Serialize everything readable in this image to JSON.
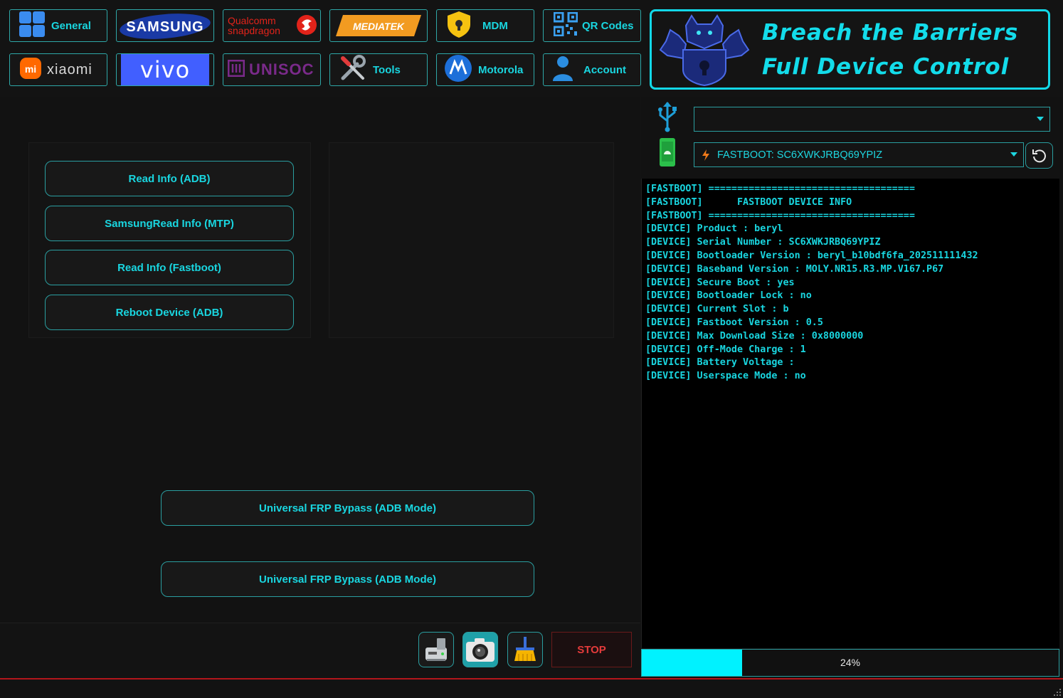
{
  "tabs_row1": [
    {
      "label": "General",
      "icon": "grid-icon"
    },
    {
      "label": "SAMSUNG",
      "icon": "samsung-logo"
    },
    {
      "label": "Qualcomm snapdragon",
      "icon": "snapdragon-logo"
    },
    {
      "label": "MEDIATEK",
      "icon": "mediatek-logo"
    },
    {
      "label": "MDM",
      "icon": "shield-lock-icon"
    },
    {
      "label": "QR Codes",
      "icon": "qr-code-icon"
    }
  ],
  "tabs_row2": [
    {
      "label": "xiaomi",
      "icon": "mi-logo"
    },
    {
      "label": "vivo",
      "icon": "vivo-logo"
    },
    {
      "label": "UNISOC",
      "icon": "unisoc-logo"
    },
    {
      "label": "Tools",
      "icon": "wrench-screwdriver-icon"
    },
    {
      "label": "Motorola",
      "icon": "motorola-logo"
    },
    {
      "label": "Account",
      "icon": "user-icon"
    }
  ],
  "banner": {
    "line1": "Breach the Barriers",
    "line2": "Full Device Control",
    "logo": "cerberus-lock-logo"
  },
  "buttons": {
    "read_adb": "Read Info (ADB)",
    "samsung_mtp": "SamsungRead Info (MTP)",
    "read_fastboot": "Read Info (Fastboot)",
    "reboot_adb": "Reboot Device (ADB)",
    "frp1": "Universal FRP Bypass (ADB Mode)",
    "frp2": "Universal FRP Bypass (ADB Mode)",
    "stop": "STOP"
  },
  "port_select": {
    "value": ""
  },
  "device_select": {
    "value": "FASTBOOT: SC6XWKJRBQ69YPIZ"
  },
  "console_lines": [
    "[FASTBOOT] ====================================",
    "[FASTBOOT]      FASTBOOT DEVICE INFO",
    "[FASTBOOT] ====================================",
    "[DEVICE] Product : beryl",
    "[DEVICE] Serial Number : SC6XWKJRBQ69YPIZ",
    "[DEVICE] Bootloader Version : beryl_b10bdf6fa_202511111432",
    "[DEVICE] Baseband Version : MOLY.NR15.R3.MP.V167.P67",
    "[DEVICE] Secure Boot : yes",
    "[DEVICE] Bootloader Lock : no",
    "[DEVICE] Current Slot : b",
    "[DEVICE] Fastboot Version : 0.5",
    "[DEVICE] Max Download Size : 0x8000000",
    "[DEVICE] Off-Mode Charge : 1",
    "[DEVICE] Battery Voltage :",
    "[DEVICE] Userspace Mode : no"
  ],
  "progress": {
    "value": 0.24,
    "label": "24%"
  },
  "colors": {
    "accent": "#19d6e0",
    "stop": "#e43b3b",
    "progress": "#00f2ff",
    "vivo_bg": "#415fff"
  }
}
